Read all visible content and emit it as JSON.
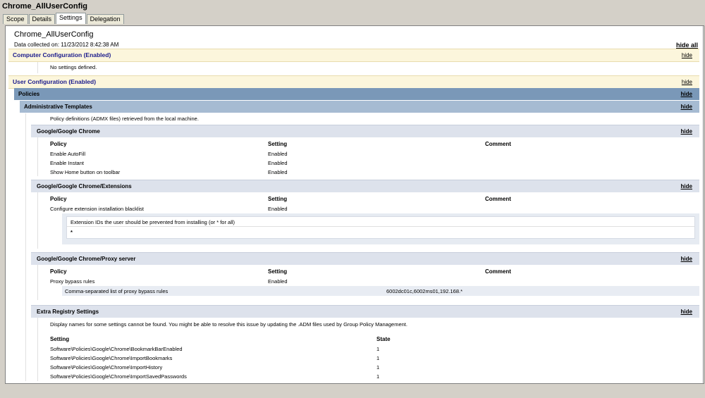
{
  "window": {
    "title": "Chrome_AllUserConfig"
  },
  "tabs": [
    {
      "label": "Scope"
    },
    {
      "label": "Details"
    },
    {
      "label": "Settings"
    },
    {
      "label": "Delegation"
    }
  ],
  "report": {
    "title": "Chrome_AllUserConfig",
    "collected": "Data collected on: 11/23/2012 8:42:38 AM",
    "hide_all": "hide all",
    "hide": "hide",
    "computer_config": {
      "label": "Computer Configuration (Enabled)",
      "empty_text": "No settings defined."
    },
    "user_config": {
      "label": "User Configuration (Enabled)",
      "policies": "Policies",
      "admin_templates": "Administrative Templates",
      "admx_note": "Policy definitions (ADMX files) retrieved from the local machine.",
      "chrome": {
        "label": "Google/Google Chrome",
        "headers": [
          "Policy",
          "Setting",
          "Comment"
        ],
        "rows": [
          {
            "policy": "Enable AutoFill",
            "setting": "Enabled"
          },
          {
            "policy": "Enable Instant",
            "setting": "Enabled"
          },
          {
            "policy": "Show Home button on toolbar",
            "setting": "Enabled"
          }
        ]
      },
      "extensions": {
        "label": "Google/Google Chrome/Extensions",
        "headers": [
          "Policy",
          "Setting",
          "Comment"
        ],
        "rows": [
          {
            "policy": "Configure extension installation blacklist",
            "setting": "Enabled"
          }
        ],
        "sub_label": "Extension IDs the user should be prevented from installing (or * for all)",
        "sub_value": "*"
      },
      "proxy": {
        "label": "Google/Google Chrome/Proxy server",
        "headers": [
          "Policy",
          "Setting",
          "Comment"
        ],
        "rows": [
          {
            "policy": "Proxy bypass rules",
            "setting": "Enabled"
          }
        ],
        "sub_label": "Comma-separated list of proxy bypass rules",
        "sub_value": "6002dc01c,6002ms01,192.168.*"
      },
      "extra": {
        "label": "Extra Registry Settings",
        "note": "Display names for some settings cannot be found. You might be able to resolve this issue by updating the .ADM files used by Group Policy Management.",
        "headers": [
          "Setting",
          "State"
        ],
        "rows": [
          {
            "setting": "Software\\Policies\\Google\\Chrome\\BookmarkBarEnabled",
            "state": "1"
          },
          {
            "setting": "Software\\Policies\\Google\\Chrome\\ImportBookmarks",
            "state": "1"
          },
          {
            "setting": "Software\\Policies\\Google\\Chrome\\ImportHistory",
            "state": "1"
          },
          {
            "setting": "Software\\Policies\\Google\\Chrome\\ImportSavedPasswords",
            "state": "1"
          }
        ]
      }
    }
  }
}
